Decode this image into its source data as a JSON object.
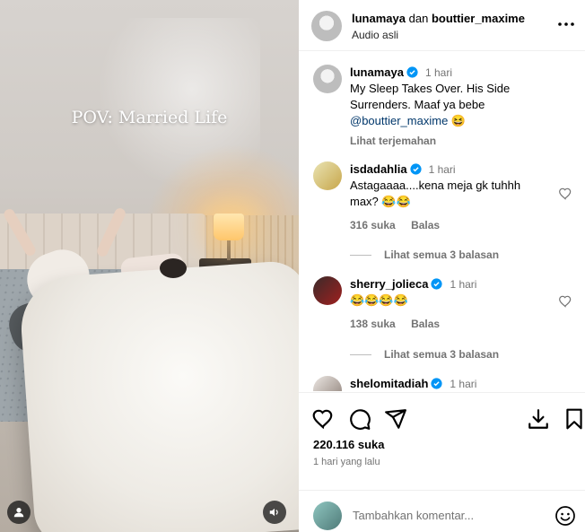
{
  "media": {
    "overlay_text": "POV: Married Life",
    "icons": {
      "user_tags": "person-icon",
      "audio": "speaker-icon"
    }
  },
  "header": {
    "author": "lunamaya",
    "connector": "dan",
    "coauthor": "bouttier_maxime",
    "audio_label": "Audio asli",
    "more_icon": "more-horizontal-icon"
  },
  "caption": {
    "username": "lunamaya",
    "time": "1 hari",
    "text_line1": "My Sleep Takes Over. His Side",
    "text_line2": "Surrenders. Maaf ya bebe",
    "mention": "@bouttier_maxime",
    "emoji": "😆",
    "see_translation": "Lihat terjemahan"
  },
  "comments": [
    {
      "username": "isdadahlia",
      "time": "1 hari",
      "text": "Astagaaaa....kena meja gk tuhhh max? 😂😂",
      "likes": "316 suka",
      "reply": "Balas",
      "view_replies": "Lihat semua 3 balasan"
    },
    {
      "username": "sherry_jolieca",
      "time": "1 hari",
      "text": "😂😂😂😂",
      "likes": "138 suka",
      "reply": "Balas",
      "view_replies": "Lihat semua 3 balasan"
    },
    {
      "username": "shelomitadiah",
      "time": "1 hari"
    }
  ],
  "actions": {
    "likes": "220.116 suka",
    "date": "1 hari yang lalu",
    "icons": [
      "heart-icon",
      "comment-icon",
      "share-icon",
      "download-icon",
      "bookmark-icon"
    ]
  },
  "add_comment": {
    "placeholder": "Tambahkan komentar...",
    "emoji_icon": "smiley-icon"
  },
  "colors": {
    "verified": "#0095f6",
    "mention": "#00376b",
    "muted": "#737373"
  }
}
